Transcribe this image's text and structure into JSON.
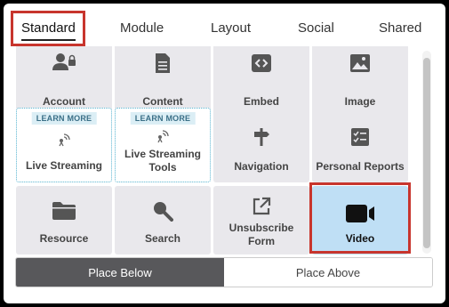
{
  "tabs": [
    {
      "label": "Standard",
      "active": true
    },
    {
      "label": "Module"
    },
    {
      "label": "Layout"
    },
    {
      "label": "Social"
    },
    {
      "label": "Shared"
    }
  ],
  "tiles": [
    {
      "label": "Account",
      "icon": "account-lock-icon"
    },
    {
      "label": "Content",
      "icon": "document-icon"
    },
    {
      "label": "Embed",
      "icon": "code-icon"
    },
    {
      "label": "Image",
      "icon": "image-icon"
    },
    {
      "label": "Live Streaming",
      "icon": "broadcast-icon",
      "badge": "LEARN MORE"
    },
    {
      "label": "Live Streaming Tools",
      "icon": "broadcast-icon",
      "badge": "LEARN MORE"
    },
    {
      "label": "Navigation",
      "icon": "signpost-icon"
    },
    {
      "label": "Personal Reports",
      "icon": "checklist-icon"
    },
    {
      "label": "Resource",
      "icon": "folder-icon"
    },
    {
      "label": "Search",
      "icon": "search-icon"
    },
    {
      "label": "Unsubscribe Form",
      "icon": "external-link-icon"
    },
    {
      "label": "Video",
      "icon": "video-camera-icon",
      "selected": true
    }
  ],
  "placement": {
    "below": "Place Below",
    "above": "Place Above",
    "active": "below"
  },
  "colors": {
    "highlight": "#c8352d",
    "selected_tile": "#bfdff5",
    "tile": "#e9e8ec",
    "toggle_active": "#58585b",
    "learn_more_border": "#57b4d0"
  }
}
